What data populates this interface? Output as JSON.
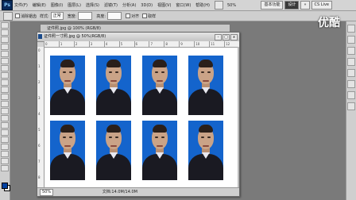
{
  "menubar": {
    "logo": "Ps",
    "items": [
      "文件(F)",
      "编辑(E)",
      "图像(I)",
      "图层(L)",
      "选择(S)",
      "滤镜(T)",
      "分析(A)",
      "3D(D)",
      "视图(V)",
      "窗口(W)",
      "帮助(H)"
    ],
    "zoom": "50%",
    "workspace_basic": "基本功能",
    "workspace_design": "设计",
    "workspace_more": "»",
    "cs_live": "CS Live"
  },
  "options": {
    "style_label": "样式:",
    "style_value": "正常",
    "width_label": "宽度:",
    "height_label": "高度:",
    "checkbox1": "消除锯齿",
    "checkbox2": "对齐",
    "checkbox3": "取样"
  },
  "watermark": "优酷",
  "back_window": {
    "title": "证件照.jpg @ 100% (RGB/8)"
  },
  "document": {
    "title": "证件照一寸照.jpg @ 50%(RGB/8)",
    "btn_min": "-",
    "btn_max": "□",
    "btn_close": "x",
    "ruler_h": [
      "0",
      "1",
      "2",
      "3",
      "4",
      "5",
      "6",
      "7",
      "8",
      "9",
      "10",
      "11",
      "12"
    ],
    "ruler_v": [
      "0",
      "1",
      "2",
      "3",
      "4",
      "5",
      "6",
      "7",
      "8"
    ],
    "status_zoom": "50%",
    "status_info": "文档:14.0M/14.0M"
  }
}
